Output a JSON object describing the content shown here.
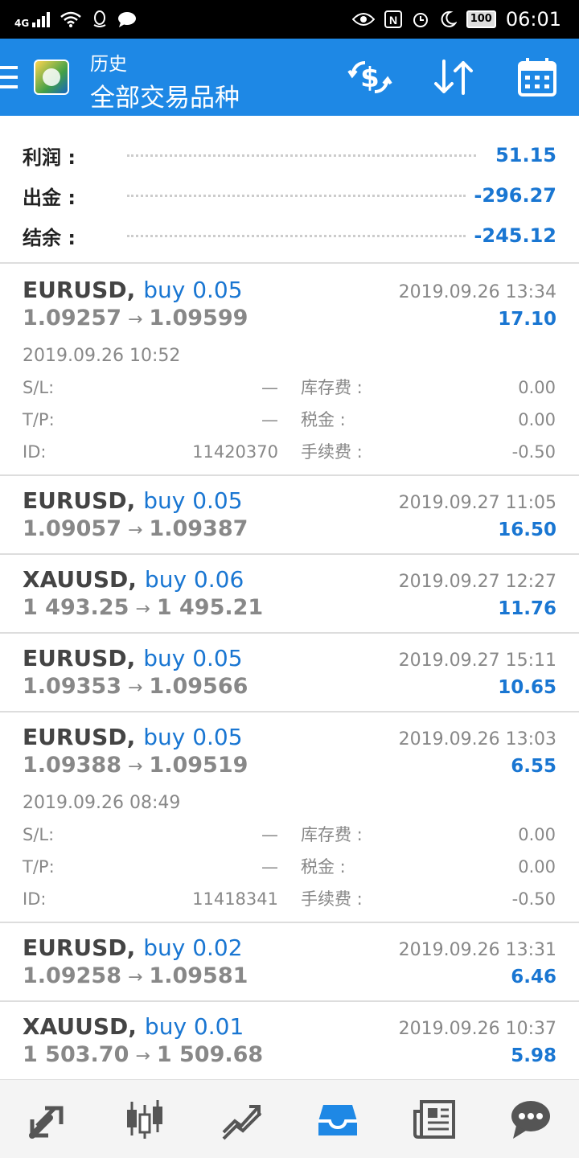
{
  "status_bar": {
    "network": "4G",
    "battery": "100",
    "time": "06:01"
  },
  "header": {
    "subtitle": "历史",
    "title": "全部交易品种"
  },
  "summary": [
    {
      "label": "利润 :",
      "value": "51.15"
    },
    {
      "label": "出金 :",
      "value": "-296.27"
    },
    {
      "label": "结余 :",
      "value": "-245.12"
    }
  ],
  "detail_labels": {
    "sl": "S/L:",
    "tp": "T/P:",
    "id": "ID:",
    "swap": "库存费 :",
    "tax": "税金 :",
    "fee": "手续费 :"
  },
  "deals": [
    {
      "symbol": "EURUSD,",
      "direction": "buy 0.05",
      "close_time": "2019.09.26 13:34",
      "open_price": "1.09257",
      "close_price": "1.09599",
      "profit": "17.10",
      "expanded": true,
      "open_time": "2019.09.26 10:52",
      "sl": "—",
      "tp": "—",
      "id": "11420370",
      "swap": "0.00",
      "tax": "0.00",
      "fee": "-0.50"
    },
    {
      "symbol": "EURUSD,",
      "direction": "buy 0.05",
      "close_time": "2019.09.27 11:05",
      "open_price": "1.09057",
      "close_price": "1.09387",
      "profit": "16.50",
      "expanded": false
    },
    {
      "symbol": "XAUUSD,",
      "direction": "buy 0.06",
      "close_time": "2019.09.27 12:27",
      "open_price": "1 493.25",
      "close_price": "1 495.21",
      "profit": "11.76",
      "expanded": false
    },
    {
      "symbol": "EURUSD,",
      "direction": "buy 0.05",
      "close_time": "2019.09.27 15:11",
      "open_price": "1.09353",
      "close_price": "1.09566",
      "profit": "10.65",
      "expanded": false
    },
    {
      "symbol": "EURUSD,",
      "direction": "buy 0.05",
      "close_time": "2019.09.26 13:03",
      "open_price": "1.09388",
      "close_price": "1.09519",
      "profit": "6.55",
      "expanded": true,
      "open_time": "2019.09.26 08:49",
      "sl": "—",
      "tp": "—",
      "id": "11418341",
      "swap": "0.00",
      "tax": "0.00",
      "fee": "-0.50"
    },
    {
      "symbol": "EURUSD,",
      "direction": "buy 0.02",
      "close_time": "2019.09.26 13:31",
      "open_price": "1.09258",
      "close_price": "1.09581",
      "profit": "6.46",
      "expanded": false
    },
    {
      "symbol": "XAUUSD,",
      "direction": "buy 0.01",
      "close_time": "2019.09.26 10:37",
      "open_price": "1 503.70",
      "close_price": "1 509.68",
      "profit": "5.98",
      "expanded": false
    }
  ],
  "arrow": "→",
  "colors": {
    "accent": "#1e88e5",
    "value_blue": "#1976d2",
    "muted": "#888888"
  },
  "bottom_nav": [
    "quotes-icon",
    "chart-candles-icon",
    "trade-icon",
    "history-icon",
    "news-icon",
    "chat-icon"
  ]
}
